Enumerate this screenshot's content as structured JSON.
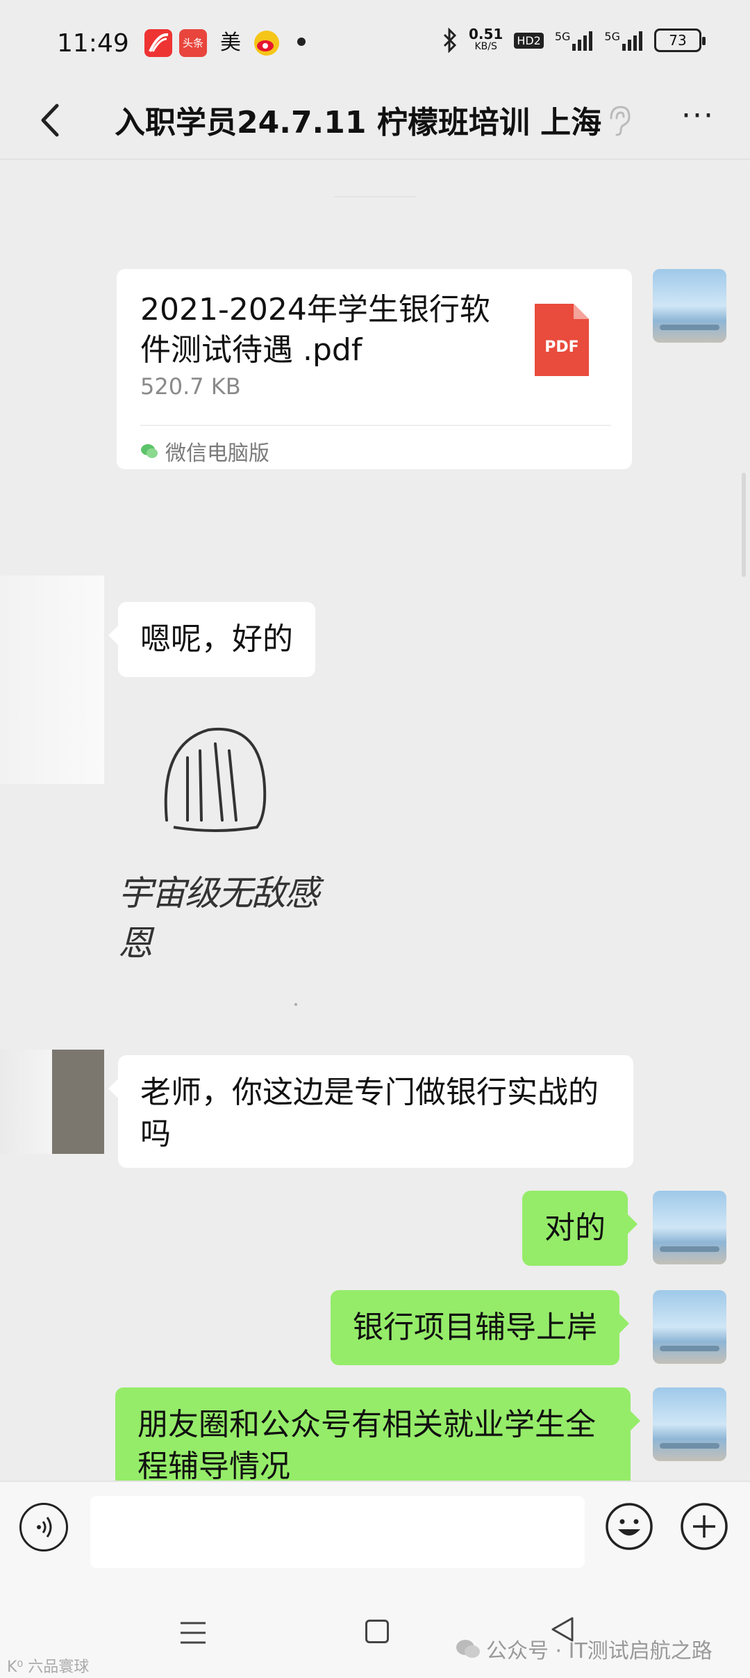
{
  "status_bar": {
    "time": "11:49",
    "app_icons": [
      "xuexi-app-icon",
      "toutiao-app-icon",
      "meituan-app-icon",
      "weibo-app-icon"
    ],
    "toutiao_label": "头条",
    "meituan_label": "美",
    "net_speed": "0.51",
    "net_speed_unit": "KB/S",
    "hd_label": "HD2",
    "signal1_label": "5G",
    "signal2_label": "5G",
    "battery": "73"
  },
  "header": {
    "title": "入职学员24.7.11 柠檬班培训 上海",
    "more": "···"
  },
  "messages": {
    "file": {
      "name": "2021-2024年学生银行软件测试待遇 .pdf",
      "size": "520.7 KB",
      "source": "微信电脑版",
      "badge": "PDF"
    },
    "reply_ok": "嗯呢，好的",
    "sticker_caption": "宇宙级无敌感恩",
    "question": "老师，你这边是专门做银行实战的吗",
    "answer_yes": "对的",
    "answer_project": "银行项目辅导上岸",
    "answer_moments": "朋友圈和公众号有相关就业学生全程辅导情况"
  },
  "input": {
    "value": "",
    "placeholder": ""
  },
  "watermark": {
    "text": "公众号 · IT测试启航之路",
    "left_text": "K⁰ 六品寰球"
  },
  "colors": {
    "background": "#ededed",
    "self_bubble": "#95ec69",
    "other_bubble": "#ffffff",
    "pdf_red": "#e94b3c"
  }
}
